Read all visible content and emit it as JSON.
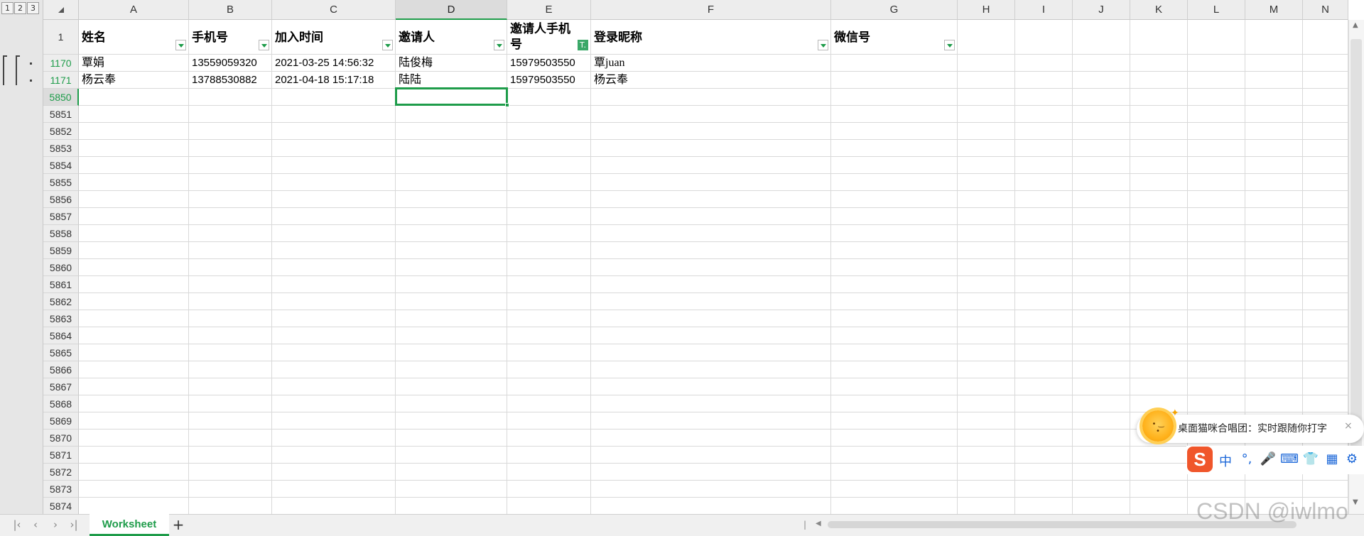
{
  "outline": {
    "levels": [
      "1",
      "2",
      "3"
    ]
  },
  "columns": [
    "A",
    "B",
    "C",
    "D",
    "E",
    "F",
    "G",
    "H",
    "I",
    "J",
    "K",
    "L",
    "M",
    "N"
  ],
  "selected_column": "D",
  "header_row": {
    "row_label": "1",
    "cells": [
      "姓名",
      "手机号",
      "加入时间",
      "邀请人",
      "邀请人手机号",
      "登录昵称",
      "微信号"
    ],
    "active_filter_icon": "T."
  },
  "data_rows": [
    {
      "row_label": "1170",
      "cells": [
        "覃娟",
        "13559059320",
        "2021-03-25 14:56:32",
        "陆俊梅",
        "15979503550",
        "覃juan",
        ""
      ]
    },
    {
      "row_label": "1171",
      "cells": [
        "杨云奉",
        "13788530882",
        "2021-04-18 15:17:18",
        "陆陆",
        "15979503550",
        "杨云奉",
        ""
      ]
    }
  ],
  "empty_row_labels": [
    "5850",
    "5851",
    "5852",
    "5853",
    "5854",
    "5855",
    "5856",
    "5857",
    "5858",
    "5859",
    "5860",
    "5861",
    "5862",
    "5863",
    "5864",
    "5865",
    "5866",
    "5867",
    "5868",
    "5869",
    "5870",
    "5871",
    "5872",
    "5873",
    "5874"
  ],
  "selected_row": "5850",
  "sheet_tabs": [
    {
      "label": "Worksheet",
      "active": true
    }
  ],
  "add_sheet_label": "+",
  "ime_popup": {
    "message": "桌面猫咪合唱团：实时跟随你打字",
    "close": "×"
  },
  "ime_toolbar": {
    "logo": "S",
    "items": [
      "中",
      "°,",
      "🎤",
      "⌨",
      "👕",
      "▦",
      "⚙"
    ]
  },
  "watermark": "CSDN @iwlmo",
  "colors": {
    "accent": "#1e9c4a",
    "header_bg": "#ededed",
    "grid": "#d9d9d9",
    "ime_brand": "#f0562b"
  }
}
